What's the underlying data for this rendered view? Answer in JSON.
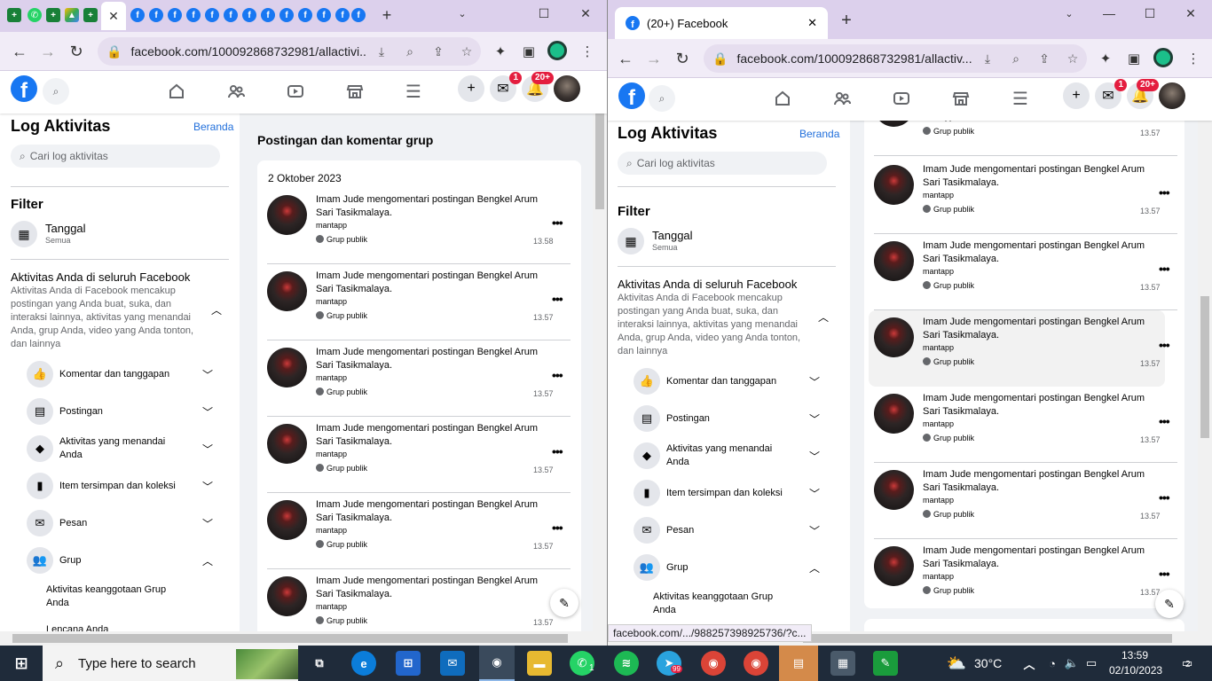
{
  "colors": {
    "fb_blue": "#1877f2",
    "link": "#216fdb",
    "badge": "#e41e3f",
    "tab_bg": "#dcd0ec",
    "taskbar": "#1f2b3a"
  },
  "left": {
    "url": "facebook.com/100092868732981/allactivi...",
    "tab_favicons": [
      "sheets-icon",
      "whatsapp-icon",
      "sheets-icon",
      "drive-icon",
      "sheets-icon",
      "close-icon",
      "facebook-icon",
      "facebook-icon",
      "facebook-icon",
      "facebook-icon",
      "facebook-icon",
      "facebook-icon",
      "facebook-icon",
      "facebook-icon",
      "facebook-icon",
      "facebook-icon",
      "facebook-icon",
      "facebook-icon",
      "new-tab-icon"
    ],
    "badges": {
      "messenger": "1",
      "notifications": "20+"
    },
    "sidebar": {
      "title": "Log Aktivitas",
      "home_link": "Beranda",
      "search_placeholder": "Cari log aktivitas",
      "filter": "Filter",
      "date_label": "Tanggal",
      "date_value": "Semua",
      "activity_title": "Aktivitas Anda di seluruh Facebook",
      "activity_desc": "Aktivitas Anda di Facebook mencakup postingan yang Anda buat, suka, dan interaksi lainnya, aktivitas yang menandai Anda, grup Anda, video yang Anda tonton, dan lainnya",
      "categories": [
        {
          "label": "Komentar dan tanggapan",
          "icon": "like-icon"
        },
        {
          "label": "Postingan",
          "icon": "post-icon"
        },
        {
          "label": "Aktivitas yang menandai Anda",
          "icon": "tag-icon"
        },
        {
          "label": "Item tersimpan dan koleksi",
          "icon": "bookmark-icon"
        },
        {
          "label": "Pesan",
          "icon": "messenger-icon"
        },
        {
          "label": "Grup",
          "icon": "group-icon"
        }
      ],
      "sub": [
        "Aktivitas keanggotaan Grup Anda",
        "Lencana Anda"
      ]
    },
    "panel": {
      "title": "Postingan dan komentar grup",
      "date": "2 Oktober 2023"
    },
    "items": [
      {
        "text": "Imam Jude mengomentari postingan Bengkel Arum Sari Tasikmalaya.",
        "comment": "mantapp",
        "privacy": "Grup publik",
        "time": "13.58"
      },
      {
        "text": "Imam Jude mengomentari postingan Bengkel Arum Sari Tasikmalaya.",
        "comment": "mantapp",
        "privacy": "Grup publik",
        "time": "13.57"
      },
      {
        "text": "Imam Jude mengomentari postingan Bengkel Arum Sari Tasikmalaya.",
        "comment": "mantapp",
        "privacy": "Grup publik",
        "time": "13.57"
      },
      {
        "text": "Imam Jude mengomentari postingan Bengkel Arum Sari Tasikmalaya.",
        "comment": "mantapp",
        "privacy": "Grup publik",
        "time": "13.57"
      },
      {
        "text": "Imam Jude mengomentari postingan Bengkel Arum Sari Tasikmalaya.",
        "comment": "mantapp",
        "privacy": "Grup publik",
        "time": "13.57"
      },
      {
        "text": "Imam Jude mengomentari postingan Bengkel Arum Sari Tasikmalaya.",
        "comment": "mantapp",
        "privacy": "Grup publik",
        "time": "13.57"
      }
    ]
  },
  "right": {
    "tab_title": "(20+) Facebook",
    "url": "facebook.com/100092868732981/allactiv...",
    "status_url": "facebook.com/.../988257398925736/?c...",
    "badges": {
      "messenger": "1",
      "notifications": "20+"
    },
    "sidebar": {
      "title": "Log Aktivitas",
      "home_link": "Beranda",
      "search_placeholder": "Cari log aktivitas",
      "filter": "Filter",
      "date_label": "Tanggal",
      "date_value": "Semua",
      "activity_title": "Aktivitas Anda di seluruh Facebook",
      "activity_desc": "Aktivitas Anda di Facebook mencakup postingan yang Anda buat, suka, dan interaksi lainnya, aktivitas yang menandai Anda, grup Anda, video yang Anda tonton, dan lainnya",
      "categories": [
        {
          "label": "Komentar dan tanggapan",
          "icon": "like-icon"
        },
        {
          "label": "Postingan",
          "icon": "post-icon"
        },
        {
          "label": "Aktivitas yang menandai Anda",
          "icon": "tag-icon"
        },
        {
          "label": "Item tersimpan dan koleksi",
          "icon": "bookmark-icon"
        },
        {
          "label": "Pesan",
          "icon": "messenger-icon"
        },
        {
          "label": "Grup",
          "icon": "group-icon"
        }
      ],
      "sub": [
        "Aktivitas keanggotaan Grup Anda"
      ]
    },
    "top_item": {
      "comment": "mantapp",
      "privacy": "Grup publik",
      "time": "13.57"
    },
    "items": [
      {
        "text": "Imam Jude mengomentari postingan Bengkel Arum Sari Tasikmalaya.",
        "comment": "mantapp",
        "privacy": "Grup publik",
        "time": "13.57"
      },
      {
        "text": "Imam Jude mengomentari postingan Bengkel Arum Sari Tasikmalaya.",
        "comment": "mantapp",
        "privacy": "Grup publik",
        "time": "13.57"
      },
      {
        "text": "Imam Jude mengomentari postingan Bengkel Arum Sari Tasikmalaya.",
        "comment": "mantapp",
        "privacy": "Grup publik",
        "time": "13.57"
      },
      {
        "text": "Imam Jude mengomentari postingan Bengkel Arum Sari Tasikmalaya.",
        "comment": "mantapp",
        "privacy": "Grup publik",
        "time": "13.57"
      },
      {
        "text": "Imam Jude mengomentari postingan Bengkel Arum Sari Tasikmalaya.",
        "comment": "mantapp",
        "privacy": "Grup publik",
        "time": "13.57"
      },
      {
        "text": "Imam Jude mengomentari postingan Bengkel Arum Sari Tasikmalaya.",
        "comment": "mantapp",
        "privacy": "Grup publik",
        "time": "13.57"
      }
    ]
  },
  "taskbar": {
    "search_placeholder": "Type here to search",
    "temperature": "30°C",
    "time": "13:59",
    "date": "02/10/2023",
    "notifications": "2",
    "whatsapp_count": "1",
    "telegram_count": "99"
  }
}
